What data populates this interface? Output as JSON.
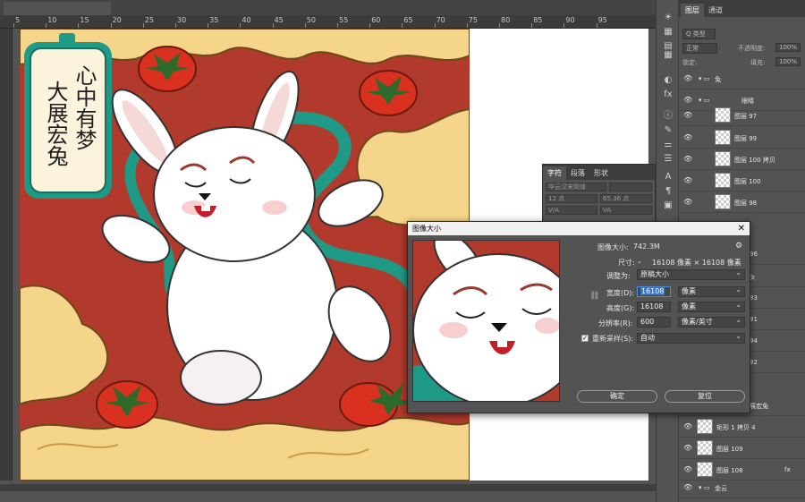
{
  "ruler": {
    "ticks": [
      "5",
      "10",
      "15",
      "20",
      "25",
      "30",
      "35",
      "40",
      "45",
      "50",
      "55",
      "60",
      "65",
      "70",
      "75",
      "80",
      "85",
      "90",
      "95"
    ]
  },
  "artwork": {
    "poem_col1": "心中有梦",
    "poem_col2": "大展宏兔"
  },
  "character_panel": {
    "tabs": [
      "字符",
      "段落",
      "形状"
    ],
    "font": "华云汉宋简体",
    "size": "12 点",
    "leading": "65.36 点",
    "va": "V/A",
    "va_value": "VA"
  },
  "layers_panel": {
    "tabs": [
      "图层",
      "通道"
    ],
    "filter_label": "Q 类型",
    "blend_mode": "正常",
    "opacity_label": "不透明度:",
    "opacity_value": "100%",
    "lock_label": "锁定:",
    "fill_label": "填充:",
    "fill_value": "100%",
    "rows": [
      {
        "name": "兔",
        "type": "group"
      },
      {
        "name": "眼睛",
        "type": "group"
      },
      {
        "name": "图层 97",
        "type": "layer"
      },
      {
        "name": "图层 99",
        "type": "layer"
      },
      {
        "name": "图层 100 拷贝",
        "type": "layer"
      },
      {
        "name": "图层 100",
        "type": "layer"
      },
      {
        "name": "图层 98",
        "type": "layer"
      },
      {
        "name": "96",
        "type": "layer"
      },
      {
        "name": "ㄆ",
        "type": "layer"
      },
      {
        "name": "93",
        "type": "layer"
      },
      {
        "name": "91",
        "type": "layer"
      },
      {
        "name": "94",
        "type": "layer"
      },
      {
        "name": "92",
        "type": "layer"
      },
      {
        "name": "展宏兔",
        "type": "layer"
      },
      {
        "name": "矩形 1 拷贝 4",
        "type": "layer"
      },
      {
        "name": "图层 109",
        "type": "layer"
      },
      {
        "name": "图层 108",
        "type": "layer"
      },
      {
        "name": "金云",
        "type": "group"
      }
    ],
    "fx": "fx"
  },
  "dialog": {
    "title": "图像大小",
    "close": "✕",
    "image_size_label": "图像大小:",
    "image_size_value": "742.3M",
    "dimensions_label": "尺寸:",
    "dimensions_value": "16108 像素 × 16108 像素",
    "fit_to_label": "调整为:",
    "fit_to_value": "原稿大小",
    "width_label": "宽度(D):",
    "width_value": "16108",
    "width_unit": "像素",
    "height_label": "高度(G):",
    "height_value": "16108",
    "height_unit": "像素",
    "resolution_label": "分辨率(R):",
    "resolution_value": "600",
    "resolution_unit": "像素/英寸",
    "resample_label": "重新采样(S):",
    "resample_value": "自动",
    "ok": "确定",
    "reset": "复位"
  },
  "colors": {
    "bg": "#535353",
    "panel_dark": "#3d3d3d",
    "art_red": "#b13a2c",
    "art_cream": "#f4d58a",
    "art_teal": "#1f9a86",
    "accent": "#3873c8"
  }
}
